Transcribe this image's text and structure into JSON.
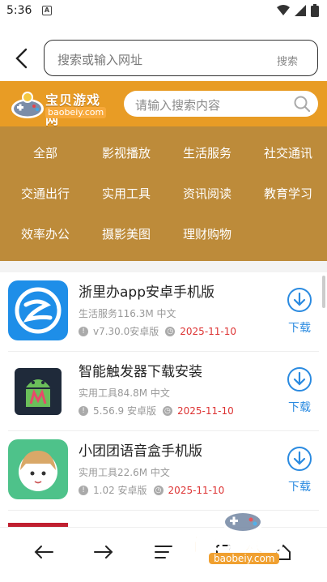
{
  "status_bar": {
    "time": "5:36",
    "notification_glyph": "A"
  },
  "address_bar": {
    "placeholder": "搜索或输入网址",
    "go_label": "搜索"
  },
  "site": {
    "logo_cn": "宝贝游戏网",
    "logo_en": "baobeiy.com",
    "search_placeholder": "请输入搜索内容",
    "brand_color": "#e89c25",
    "category_bg": "#bd8b3a"
  },
  "categories": [
    [
      "全部",
      "影视播放",
      "生活服务",
      "社交通讯"
    ],
    [
      "交通出行",
      "实用工具",
      "资讯阅读",
      "教育学习"
    ],
    [
      "效率办公",
      "摄影美图",
      "理财购物"
    ]
  ],
  "apps": [
    {
      "title": "浙里办app安卓手机版",
      "meta": "生活服务116.3M 中文",
      "version": "v7.30.0安卓版",
      "date": "2025-11-10",
      "download": "下载",
      "icon": "zheliban-icon"
    },
    {
      "title": "智能触发器下载安装",
      "meta": "实用工具84.8M 中文",
      "version": "5.56.9 安卓版",
      "date": "2025-11-10",
      "download": "下载",
      "icon": "android-trigger-icon"
    },
    {
      "title": "小团团语音盒手机版",
      "meta": "实用工具22.6M 中文",
      "version": "1.02 安卓版",
      "date": "2025-11-10",
      "download": "下载",
      "icon": "anime-girl-icon"
    }
  ],
  "watermark": {
    "cn": "宝贝游戏网",
    "en": "baobeiy.com"
  }
}
